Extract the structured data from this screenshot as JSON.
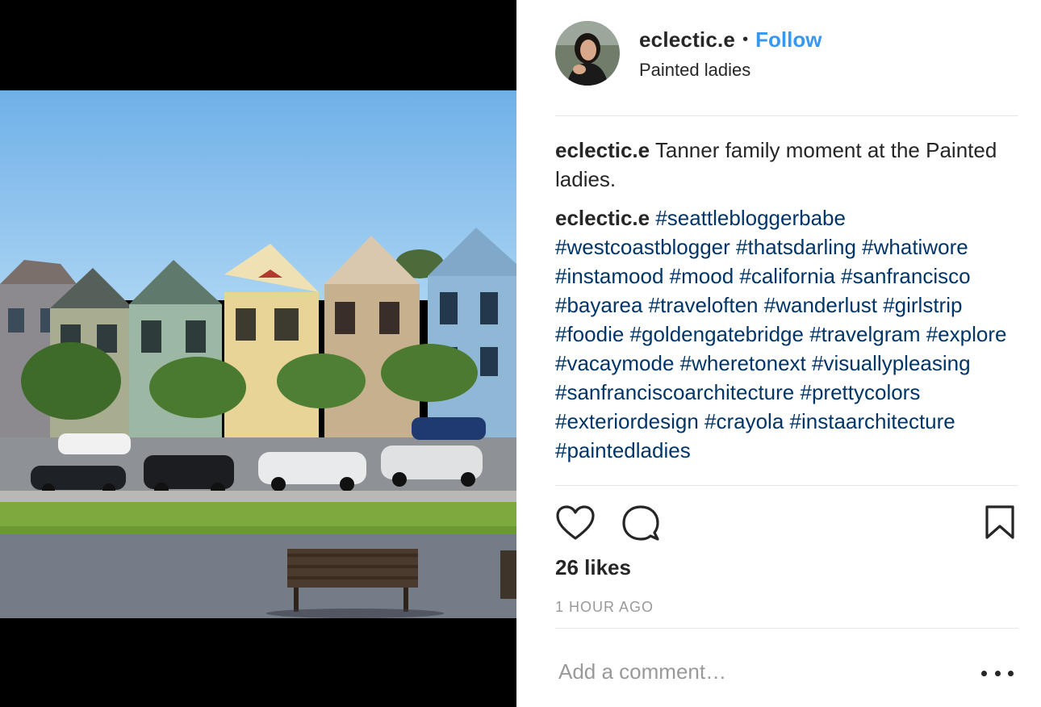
{
  "post": {
    "username": "eclectic.e",
    "separator": "•",
    "follow_label": "Follow",
    "location": "Painted ladies",
    "image_alt_name": "painted-ladies-photo"
  },
  "comments": [
    {
      "user": "eclectic.e",
      "text": "Tanner family moment at the Painted ladies.",
      "tags": []
    },
    {
      "user": "eclectic.e",
      "text": "",
      "tags": [
        "#seattlebloggerbabe",
        "#westcoastblogger",
        "#thatsdarling",
        "#whatiwore",
        "#instamood",
        "#mood",
        "#california",
        "#sanfrancisco",
        "#bayarea",
        "#traveloften",
        "#wanderlust",
        "#girlstrip",
        "#foodie",
        "#goldengatebridge",
        "#travelgram",
        "#explore",
        "#vacaymode",
        "#wheretonext",
        "#visuallypleasing",
        "#sanfranciscoarchitecture",
        "#prettycolors",
        "#exteriordesign",
        "#crayola",
        "#instaarchitecture",
        "#paintedladies"
      ]
    }
  ],
  "actions": {
    "like_icon": "heart-icon",
    "comment_icon": "speech-bubble-icon",
    "save_icon": "bookmark-icon"
  },
  "likes_text": "26 likes",
  "timestamp": "1 HOUR AGO",
  "add_comment": {
    "placeholder": "Add a comment…",
    "more_icon": "more-options-icon"
  },
  "colors": {
    "follow": "#3897f0",
    "hashtag": "#003569",
    "muted": "#999999",
    "text": "#262626",
    "divider": "#e6e6e6"
  }
}
